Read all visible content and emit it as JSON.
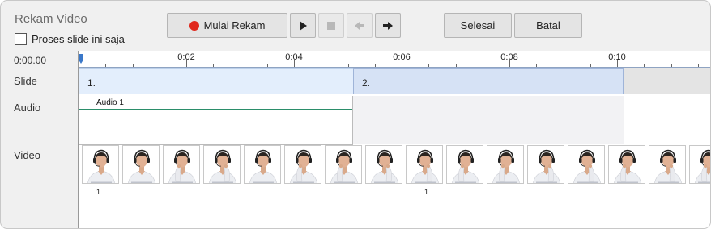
{
  "window": {
    "title": "Rekam Video"
  },
  "options": {
    "current_slide_only_label": "Proses slide ini saja"
  },
  "toolbar": {
    "record_label": "Mulai Rekam",
    "finish_label": "Selesai",
    "cancel_label": "Batal",
    "icons": [
      "play-icon",
      "stop-icon",
      "arrow-left-icon",
      "arrow-right-icon"
    ]
  },
  "timeline": {
    "current_time": "0:00.00",
    "ruler_labels": [
      "0:02",
      "0:04",
      "0:06",
      "0:08",
      "0:10"
    ],
    "track_labels": {
      "slide": "Slide",
      "audio": "Audio",
      "video": "Video"
    },
    "slides": [
      "1.",
      "2."
    ],
    "audio_clip_label": "Audio 1",
    "video_markers": [
      "1",
      "1"
    ]
  },
  "colors": {
    "record": "#e0281d",
    "accent": "#3a78c9",
    "slide_bg": "#e3eefc",
    "audio_line": "#2b8e6a"
  }
}
